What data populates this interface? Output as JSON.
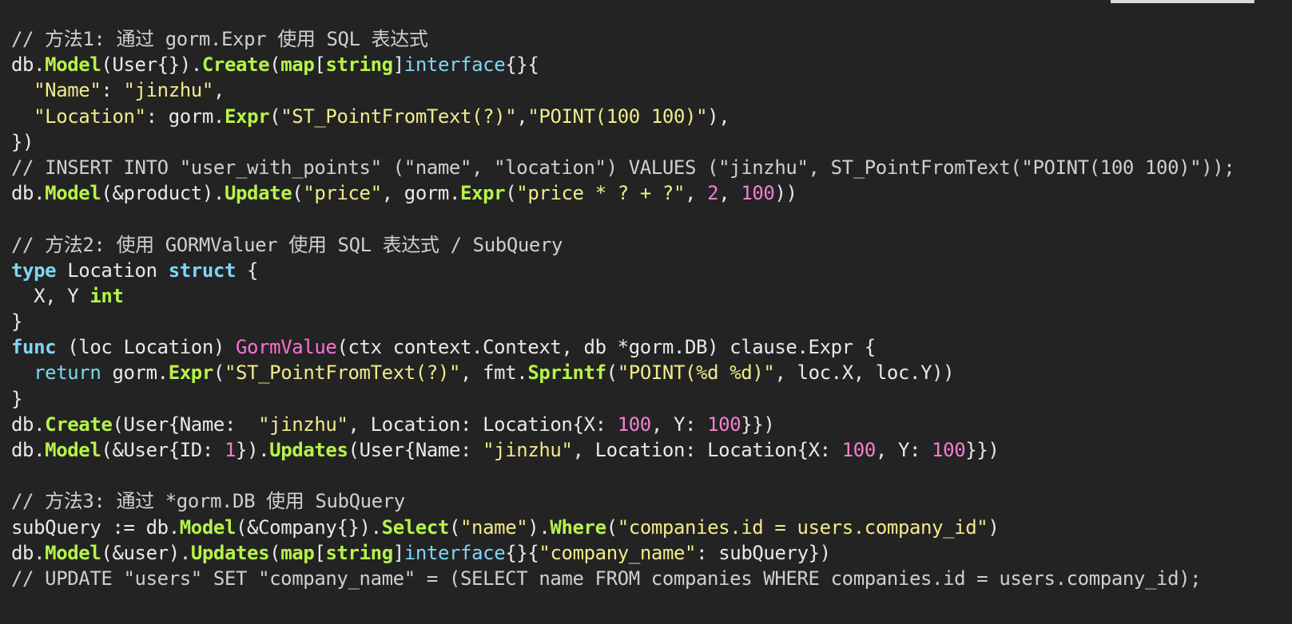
{
  "colors": {
    "background": "#232323",
    "comment": "#cfcfcf",
    "function": "#b6f34a",
    "keyword": "#7fd6f5",
    "string": "#f1eb8a",
    "number": "#f47fd0",
    "method_name": "#ff6fd8",
    "text": "#e9e9e9"
  },
  "code_lines": [
    [
      [
        "comment",
        "// 方法1: 通过 gorm.Expr 使用 SQL 表达式"
      ]
    ],
    [
      [
        "plain",
        "db."
      ],
      [
        "fn",
        "Model"
      ],
      [
        "plain",
        "(User{})."
      ],
      [
        "fn",
        "Create"
      ],
      [
        "plain",
        "("
      ],
      [
        "fn",
        "map"
      ],
      [
        "plain",
        "["
      ],
      [
        "fn",
        "string"
      ],
      [
        "plain",
        "]"
      ],
      [
        "kw",
        "interface"
      ],
      [
        "plain",
        "{}{"
      ]
    ],
    [
      [
        "plain",
        "  "
      ],
      [
        "str",
        "\"Name\""
      ],
      [
        "plain",
        ": "
      ],
      [
        "str",
        "\"jinzhu\""
      ],
      [
        "plain",
        ","
      ]
    ],
    [
      [
        "plain",
        "  "
      ],
      [
        "str",
        "\"Location\""
      ],
      [
        "plain",
        ": gorm."
      ],
      [
        "fn",
        "Expr"
      ],
      [
        "plain",
        "("
      ],
      [
        "str",
        "\"ST_PointFromText(?)\""
      ],
      [
        "plain",
        ","
      ],
      [
        "str",
        "\"POINT(100 100)\""
      ],
      [
        "plain",
        "),"
      ]
    ],
    [
      [
        "plain",
        "})"
      ]
    ],
    [
      [
        "comment",
        "// INSERT INTO \"user_with_points\" (\"name\", \"location\") VALUES (\"jinzhu\", ST_PointFromText(\"POINT(100 100)\"));"
      ]
    ],
    [
      [
        "plain",
        "db."
      ],
      [
        "fn",
        "Model"
      ],
      [
        "plain",
        "(&product)."
      ],
      [
        "fn",
        "Update"
      ],
      [
        "plain",
        "("
      ],
      [
        "str",
        "\"price\""
      ],
      [
        "plain",
        ", gorm."
      ],
      [
        "fn",
        "Expr"
      ],
      [
        "plain",
        "("
      ],
      [
        "str",
        "\"price * ? + ?\""
      ],
      [
        "plain",
        ", "
      ],
      [
        "num",
        "2"
      ],
      [
        "plain",
        ", "
      ],
      [
        "num",
        "100"
      ],
      [
        "plain",
        "))"
      ]
    ],
    [],
    [
      [
        "comment",
        "// 方法2: 使用 GORMValuer 使用 SQL 表达式 / SubQuery"
      ]
    ],
    [
      [
        "kwb",
        "type"
      ],
      [
        "plain",
        " Location "
      ],
      [
        "kwb",
        "struct"
      ],
      [
        "plain",
        " {"
      ]
    ],
    [
      [
        "plain",
        "  X, Y "
      ],
      [
        "fn",
        "int"
      ]
    ],
    [
      [
        "plain",
        "}"
      ]
    ],
    [
      [
        "kwb",
        "func"
      ],
      [
        "plain",
        " (loc Location) "
      ],
      [
        "method",
        "GormValue"
      ],
      [
        "plain",
        "(ctx context.Context, db *gorm.DB) clause.Expr {"
      ]
    ],
    [
      [
        "plain",
        "  "
      ],
      [
        "kw",
        "return"
      ],
      [
        "plain",
        " gorm."
      ],
      [
        "fn",
        "Expr"
      ],
      [
        "plain",
        "("
      ],
      [
        "str",
        "\"ST_PointFromText(?)\""
      ],
      [
        "plain",
        ", fmt."
      ],
      [
        "fn",
        "Sprintf"
      ],
      [
        "plain",
        "("
      ],
      [
        "str",
        "\"POINT(%d %d)\""
      ],
      [
        "plain",
        ", loc.X, loc.Y))"
      ]
    ],
    [
      [
        "plain",
        "}"
      ]
    ],
    [
      [
        "plain",
        "db."
      ],
      [
        "fn",
        "Create"
      ],
      [
        "plain",
        "(User{Name:  "
      ],
      [
        "str",
        "\"jinzhu\""
      ],
      [
        "plain",
        ", Location: Location{X: "
      ],
      [
        "num",
        "100"
      ],
      [
        "plain",
        ", Y: "
      ],
      [
        "num",
        "100"
      ],
      [
        "plain",
        "}})"
      ]
    ],
    [
      [
        "plain",
        "db."
      ],
      [
        "fn",
        "Model"
      ],
      [
        "plain",
        "(&User{ID: "
      ],
      [
        "num",
        "1"
      ],
      [
        "plain",
        "})."
      ],
      [
        "fn",
        "Updates"
      ],
      [
        "plain",
        "(User{Name: "
      ],
      [
        "str",
        "\"jinzhu\""
      ],
      [
        "plain",
        ", Location: Location{X: "
      ],
      [
        "num",
        "100"
      ],
      [
        "plain",
        ", Y: "
      ],
      [
        "num",
        "100"
      ],
      [
        "plain",
        "}})"
      ]
    ],
    [],
    [
      [
        "comment",
        "// 方法3: 通过 *gorm.DB 使用 SubQuery"
      ]
    ],
    [
      [
        "plain",
        "subQuery := db."
      ],
      [
        "fn",
        "Model"
      ],
      [
        "plain",
        "(&Company{})."
      ],
      [
        "fn",
        "Select"
      ],
      [
        "plain",
        "("
      ],
      [
        "str",
        "\"name\""
      ],
      [
        "plain",
        ")."
      ],
      [
        "fn",
        "Where"
      ],
      [
        "plain",
        "("
      ],
      [
        "str",
        "\"companies.id = users.company_id\""
      ],
      [
        "plain",
        ")"
      ]
    ],
    [
      [
        "plain",
        "db."
      ],
      [
        "fn",
        "Model"
      ],
      [
        "plain",
        "(&user)."
      ],
      [
        "fn",
        "Updates"
      ],
      [
        "plain",
        "("
      ],
      [
        "fn",
        "map"
      ],
      [
        "plain",
        "["
      ],
      [
        "fn",
        "string"
      ],
      [
        "plain",
        "]"
      ],
      [
        "kw",
        "interface"
      ],
      [
        "plain",
        "{}{"
      ],
      [
        "str",
        "\"company_name\""
      ],
      [
        "plain",
        ": subQuery})"
      ]
    ],
    [
      [
        "comment",
        "// UPDATE \"users\" SET \"company_name\" = (SELECT name FROM companies WHERE companies.id = users.company_id);"
      ]
    ]
  ]
}
